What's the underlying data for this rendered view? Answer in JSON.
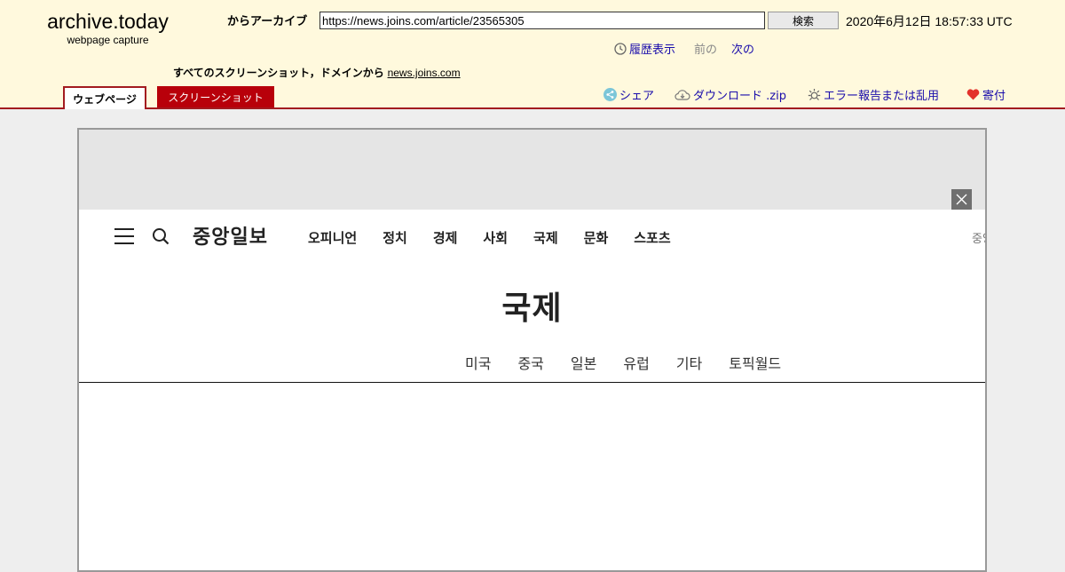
{
  "archive": {
    "logo_title": "archive.today",
    "logo_subtitle": "webpage capture",
    "from_label": "からアーカイブ",
    "url_value": "https://news.joins.com/article/23565305",
    "search_button": "検索",
    "capture_date": "2020年6月12日 18:57:33 UTC",
    "history_link": "履歴表示",
    "prev_text": "前の",
    "next_text": "次の",
    "all_screenshots_label": "すべてのスクリーンショット，ドメインから",
    "domain_link": "news.joins.com",
    "tabs": [
      {
        "label": "ウェブページ",
        "active": true
      },
      {
        "label": "スクリーンショット",
        "active": false
      }
    ],
    "actions": {
      "share": "シェア",
      "download": "ダウンロード .zip",
      "report": "エラー報告または乱用",
      "donate": "寄付"
    },
    "colors": {
      "header_bg": "#fff9dd",
      "accent": "#a31b20",
      "tab_inactive_bg": "#b8000a",
      "link": "#1a0dab"
    }
  },
  "page": {
    "brand": "중앙일보",
    "nav": [
      "오피니언",
      "정치",
      "경제",
      "사회",
      "국제",
      "문화",
      "스포츠"
    ],
    "nav_cut_text": "중앙",
    "section_title": "국제",
    "subnav": [
      "미국",
      "중국",
      "일본",
      "유럽",
      "기타",
      "토픽월드"
    ]
  }
}
